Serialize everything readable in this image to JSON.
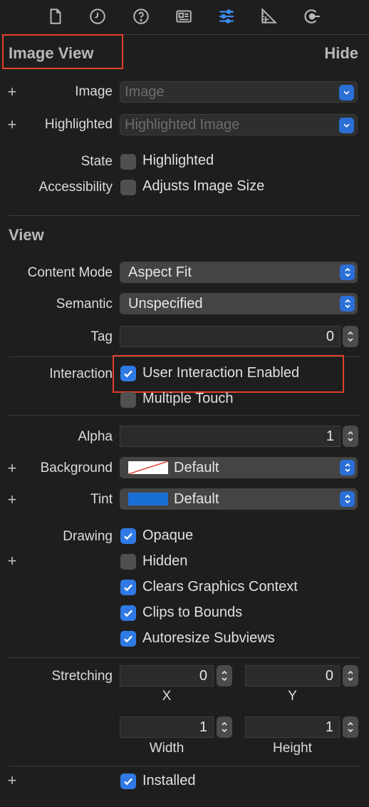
{
  "toolbar": {
    "tabs": [
      {
        "icon": "file-icon"
      },
      {
        "icon": "clock-icon"
      },
      {
        "icon": "help-icon"
      },
      {
        "icon": "identity-card-icon"
      },
      {
        "icon": "attributes-sliders-icon",
        "active": true
      },
      {
        "icon": "ruler-icon"
      },
      {
        "icon": "connections-icon"
      }
    ],
    "active_color": "#3b8ef0"
  },
  "image_view": {
    "title": "Image View",
    "hide": "Hide",
    "image_label": "Image",
    "image_placeholder": "Image",
    "highlighted_label": "Highlighted",
    "highlighted_placeholder": "Highlighted Image",
    "state_label": "State",
    "state_checkbox": "Highlighted",
    "accessibility_label": "Accessibility",
    "accessibility_checkbox": "Adjusts Image Size"
  },
  "view": {
    "title": "View",
    "content_mode_label": "Content Mode",
    "content_mode_value": "Aspect Fit",
    "semantic_label": "Semantic",
    "semantic_value": "Unspecified",
    "tag_label": "Tag",
    "tag_value": "0",
    "interaction_label": "Interaction",
    "user_interaction": "User Interaction Enabled",
    "multiple_touch": "Multiple Touch",
    "alpha_label": "Alpha",
    "alpha_value": "1",
    "background_label": "Background",
    "background_value": "Default",
    "tint_label": "Tint",
    "tint_value": "Default",
    "tint_color": "#1a6fd6",
    "drawing_label": "Drawing",
    "opaque": "Opaque",
    "hidden": "Hidden",
    "clears_graphics": "Clears Graphics Context",
    "clips_to_bounds": "Clips to Bounds",
    "autoresize": "Autoresize Subviews",
    "stretching_label": "Stretching",
    "stretch_x": "0",
    "stretch_y": "0",
    "x_label": "X",
    "y_label": "Y",
    "stretch_width": "1",
    "stretch_height": "1",
    "width_label": "Width",
    "height_label": "Height",
    "installed": "Installed"
  },
  "checkbox_states": {
    "highlighted": false,
    "adjusts_image_size": false,
    "user_interaction_enabled": true,
    "multiple_touch": false,
    "opaque": true,
    "hidden": false,
    "clears_graphics_context": true,
    "clips_to_bounds": true,
    "autoresize_subviews": true,
    "installed": true
  },
  "annotation_color": "#e0402b"
}
